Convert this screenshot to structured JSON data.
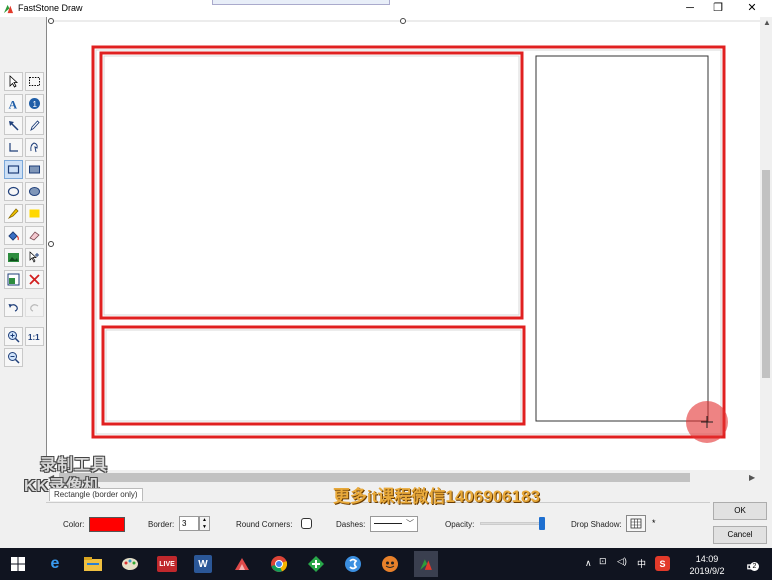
{
  "window": {
    "title": "FastStone Draw",
    "minimize": "─",
    "maximize": "❐",
    "close": "✕"
  },
  "canvas": {
    "outer_color": "#e02020",
    "rects": [
      {
        "name": "outer-red-rectangle"
      },
      {
        "name": "top-left-red-rectangle"
      },
      {
        "name": "bottom-left-red-rectangle"
      },
      {
        "name": "right-thin-rectangle"
      }
    ]
  },
  "watermark": {
    "line1": "录制工具",
    "line2": "KK录像机"
  },
  "overlay_text": "更多it课程微信1406906183",
  "properties": {
    "tab_label": "Rectangle (border only)",
    "color_label": "Color:",
    "color_value": "#ff0000",
    "border_label": "Border:",
    "border_value": "3",
    "round_corners_label": "Round Corners:",
    "dashes_label": "Dashes:",
    "opacity_label": "Opacity:",
    "opacity_value": 1.0,
    "drop_shadow_label": "Drop Shadow:",
    "drop_shadow_star": "*"
  },
  "buttons": {
    "ok": "OK",
    "cancel": "Cancel"
  },
  "taskbar": {
    "tray_input": "中",
    "clock_time": "14:09",
    "clock_date": "2019/9/2",
    "notification_count": "2"
  }
}
